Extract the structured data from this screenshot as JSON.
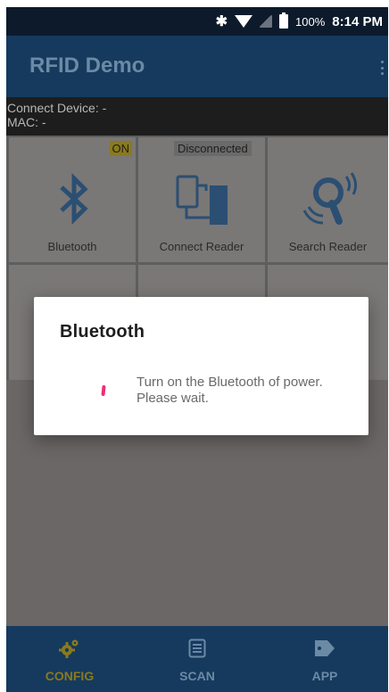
{
  "status_bar": {
    "battery": "100%",
    "time": "8:14 PM",
    "icons": [
      "bluetooth-icon",
      "wifi-icon",
      "no-sim-icon",
      "battery-icon"
    ]
  },
  "app_bar": {
    "title": "RFID Demo"
  },
  "device_info": {
    "connect_device": "Connect Device: -",
    "mac": "MAC: -"
  },
  "tiles": {
    "bluetooth": {
      "label": "Bluetooth",
      "badge": "ON",
      "icon": "bluetooth-icon"
    },
    "connect_reader": {
      "label": "Connect Reader",
      "badge": "Disconnected",
      "icon": "connect-reader-icon"
    },
    "search_reader": {
      "label": "Search Reader",
      "icon": "search-reader-icon"
    }
  },
  "dialog": {
    "title": "Bluetooth",
    "message": "Turn on the Bluetooth of power. Please wait."
  },
  "bottom_nav": {
    "items": [
      {
        "label": "CONFIG",
        "icon": "gear-icon",
        "active": true
      },
      {
        "label": "SCAN",
        "icon": "list-icon",
        "active": false
      },
      {
        "label": "APP",
        "icon": "tag-icon",
        "active": false
      }
    ]
  },
  "colors": {
    "app_bar": "#163a5d",
    "accent": "#ef2d74",
    "active_nav": "#8a7a1e",
    "inactive_nav": "#6a8aa6"
  }
}
